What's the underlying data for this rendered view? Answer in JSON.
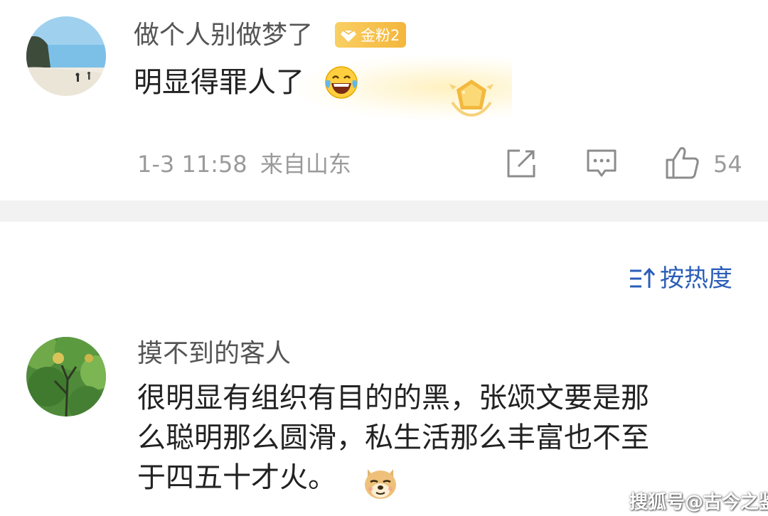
{
  "comment1": {
    "username": "做个人别做梦了",
    "badge_label": "金粉2",
    "text": "明显得罪人了",
    "emoji_icon": "laugh-cry-emoji-icon",
    "date": "1-3 11:58",
    "location": "来自山东",
    "likes": "54"
  },
  "sort": {
    "label": "按热度"
  },
  "comment2": {
    "username": "摸不到的客人",
    "text_lines": [
      "很明显有组织有目的的黑，张颂文要是那",
      "么聪明那么圆滑，私生活那么丰富也不至",
      "于四五十才火。"
    ],
    "emoji_icon": "doge-emoji-icon"
  },
  "watermark": "搜狐号@古今之鉴",
  "colors": {
    "accent_blue": "#2b5eb8",
    "badge_gold": "#f4b63c",
    "divider": "#f2f2f2"
  }
}
